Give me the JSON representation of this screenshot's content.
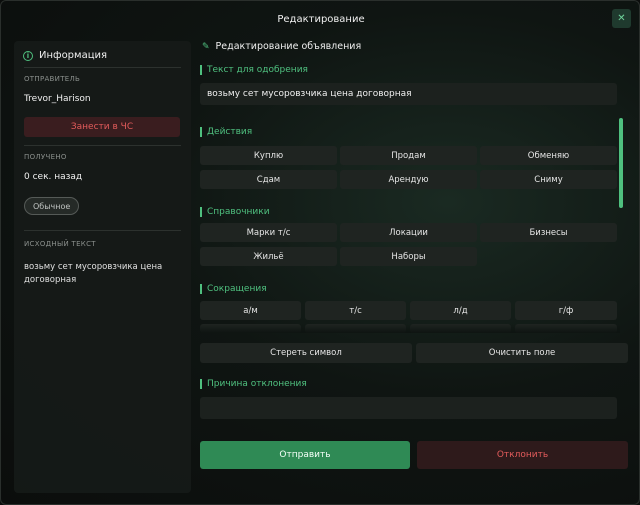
{
  "window": {
    "title": "Редактирование",
    "close_glyph": "✕"
  },
  "left": {
    "header": "Информация",
    "sender_label": "ОТПРАВИТЕЛЬ",
    "sender_value": "Trevor_Harison",
    "ban_button": "Занести в ЧС",
    "received_label": "ПОЛУЧЕНО",
    "received_value": "0 сек. назад",
    "priority_badge": "Обычное",
    "original_label": "ИСХОДНЫЙ ТЕКСТ",
    "original_text": "возьму сет мусоровзчика цена договорная"
  },
  "right": {
    "header": "Редактирование объявления",
    "approval_label": "Текст для одобрения",
    "approval_text": "возьму сет мусоровзчика цена договорная",
    "actions_label": "Действия",
    "actions": [
      "Куплю",
      "Продам",
      "Обменяю",
      "Сдам",
      "Арендую",
      "Сниму"
    ],
    "refs_label": "Справочники",
    "refs": [
      "Марки т/с",
      "Локации",
      "Бизнесы",
      "Жильё",
      "Наборы"
    ],
    "abbr_label": "Сокращения",
    "abbrs": [
      "а/м",
      "т/с",
      "л/д",
      "г/ф"
    ],
    "erase_button": "Стереть символ",
    "clear_button": "Очистить поле",
    "reason_label": "Причина отклонения",
    "reason_value": "",
    "send_button": "Отправить",
    "reject_button": "Отклонить"
  },
  "colors": {
    "accent": "#4fc07f",
    "danger": "#e25b5b",
    "primary": "#2f8a55"
  },
  "icons": {
    "info": "info-icon",
    "edit": "pencil-icon",
    "close": "close-icon"
  }
}
